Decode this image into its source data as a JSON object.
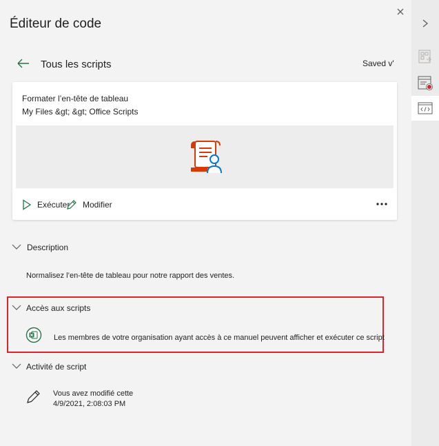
{
  "pane": {
    "title": "Éditeur de code",
    "close_icon": "close-icon"
  },
  "nav": {
    "back_icon": "back-arrow-icon",
    "title": "Tous les scripts",
    "saved": "Saved v'"
  },
  "card": {
    "title": "Formater l’en-tête de tableau",
    "path": "My Files &gt; &gt; Office Scripts",
    "illustration_icon": "script-person-icon",
    "run_label": "Exécuter",
    "edit_label": "Modifier",
    "more_icon": "more-icon"
  },
  "sections": {
    "description": {
      "label": "Description",
      "text": "Normalisez l’en-tête de tableau pour notre rapport des ventes."
    },
    "access": {
      "label": "Accès aux scripts",
      "text": "Les membres de votre organisation ayant accès à ce manuel peuvent afficher et exécuter ce script",
      "icon": "excel-icon"
    },
    "activity": {
      "label": "Activité de script",
      "line1": "Vous avez modifié cette",
      "line2": "4/9/2021, 2:08:03 PM",
      "icon": "pencil-icon"
    }
  },
  "rail": {
    "items": [
      {
        "icon": "chevron-right-icon"
      },
      {
        "icon": "script-gallery-icon"
      },
      {
        "icon": "record-actions-icon"
      },
      {
        "icon": "code-editor-icon"
      }
    ]
  },
  "colors": {
    "accent_green": "#217346",
    "brand_orange": "#d83b01",
    "highlight_red": "#d9232d",
    "person_blue": "#0078d4"
  }
}
